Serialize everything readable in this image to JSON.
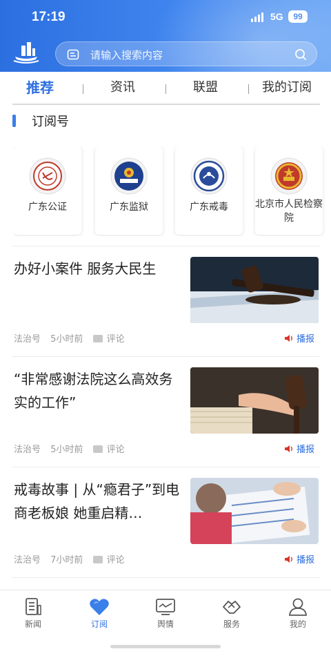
{
  "status_bar": {
    "time": "17:19",
    "network": "5G",
    "battery": "99"
  },
  "search": {
    "placeholder": "请输入搜索内容"
  },
  "tabs": [
    {
      "label": "推荐",
      "active": true
    },
    {
      "label": "资讯",
      "active": false
    },
    {
      "label": "联盟",
      "active": false
    },
    {
      "label": "我的订阅",
      "active": false
    }
  ],
  "section": {
    "title": "订阅号"
  },
  "subscriptions": [
    {
      "name": "广东公证",
      "icon": "notary-seal-icon"
    },
    {
      "name": "广东监狱",
      "icon": "police-badge-icon"
    },
    {
      "name": "广东戒毒",
      "icon": "drug-rehab-emblem-icon"
    },
    {
      "name": "北京市人民检察院",
      "icon": "national-emblem-icon"
    }
  ],
  "news": [
    {
      "title": "办好小案件 服务大民生",
      "source": "法治号",
      "time": "5小时前",
      "comment": "评论",
      "broadcast": "播报",
      "thumb": "gavel-book-image"
    },
    {
      "title": "“非常感谢法院这么高效务实的工作”",
      "source": "法治号",
      "time": "5小时前",
      "comment": "评论",
      "broadcast": "播报",
      "thumb": "gavel-hand-image"
    },
    {
      "title": "戒毒故事 | 从“瘾君子”到电商老板娘 她重启精…",
      "source": "法治号",
      "time": "7小时前",
      "comment": "评论",
      "broadcast": "播报",
      "thumb": "kids-drawing-image"
    }
  ],
  "bottom_nav": [
    {
      "label": "新闻",
      "icon": "news-icon",
      "active": false
    },
    {
      "label": "订阅",
      "icon": "heart-icon",
      "active": true
    },
    {
      "label": "舆情",
      "icon": "monitor-icon",
      "active": false
    },
    {
      "label": "服务",
      "icon": "handshake-icon",
      "active": false
    },
    {
      "label": "我的",
      "icon": "user-icon",
      "active": false
    }
  ],
  "colors": {
    "primary": "#2f6fe0",
    "header_start": "#2c6fe0",
    "header_end": "#6ea8f5"
  }
}
